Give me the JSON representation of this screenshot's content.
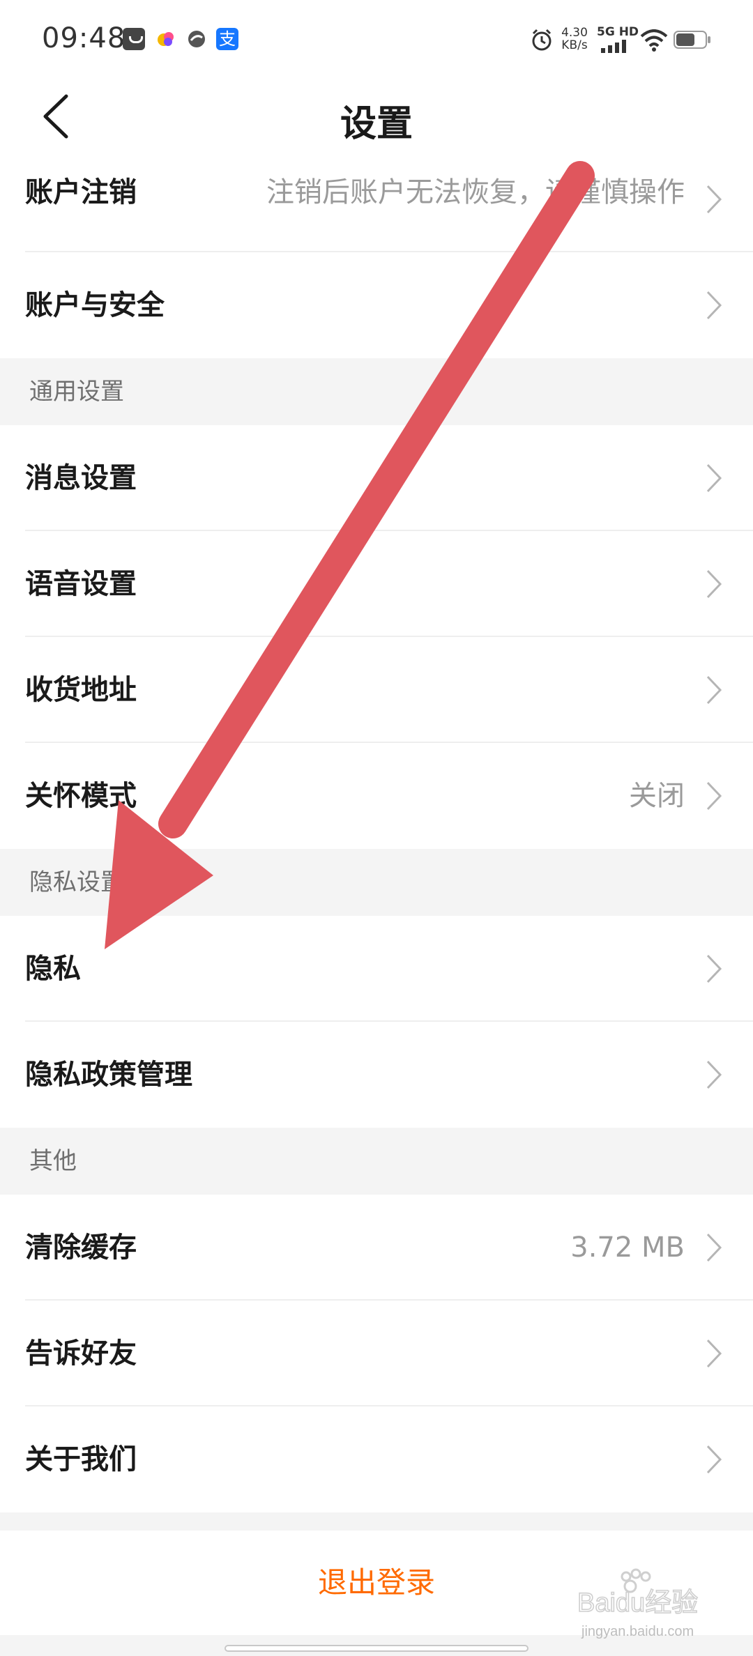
{
  "status_bar": {
    "time": "09:48",
    "net_speed_value": "4.30",
    "net_speed_unit": "KB/s",
    "network": "5G HD",
    "notification_icons": [
      "notification-bag-icon",
      "app-colorful-icon",
      "app-round-icon",
      "alipay-icon"
    ],
    "alipay_glyph": "支"
  },
  "nav": {
    "title": "设置"
  },
  "rows": {
    "account_cancel": {
      "label": "账户注销",
      "value": "注销后账户无法恢复，请谨慎操作"
    },
    "account_security": {
      "label": "账户与安全"
    },
    "message": {
      "label": "消息设置"
    },
    "voice": {
      "label": "语音设置"
    },
    "address": {
      "label": "收货地址"
    },
    "care_mode": {
      "label": "关怀模式",
      "value": "关闭"
    },
    "privacy": {
      "label": "隐私"
    },
    "privacy_policy": {
      "label": "隐私政策管理"
    },
    "clear_cache": {
      "label": "清除缓存",
      "value": "3.72 MB"
    },
    "tell_friends": {
      "label": "告诉好友"
    },
    "about_us": {
      "label": "关于我们"
    }
  },
  "sections": {
    "general": "通用设置",
    "privacy": "隐私设置",
    "other": "其他"
  },
  "logout": {
    "label": "退出登录"
  },
  "watermark": {
    "brand": "Baidu经验",
    "url": "jingyan.baidu.com"
  },
  "colors": {
    "accent": "#ff6a00",
    "annotation_arrow": "#e0565d",
    "section_bg": "#f4f4f4",
    "value_text": "#9a9a9a"
  }
}
